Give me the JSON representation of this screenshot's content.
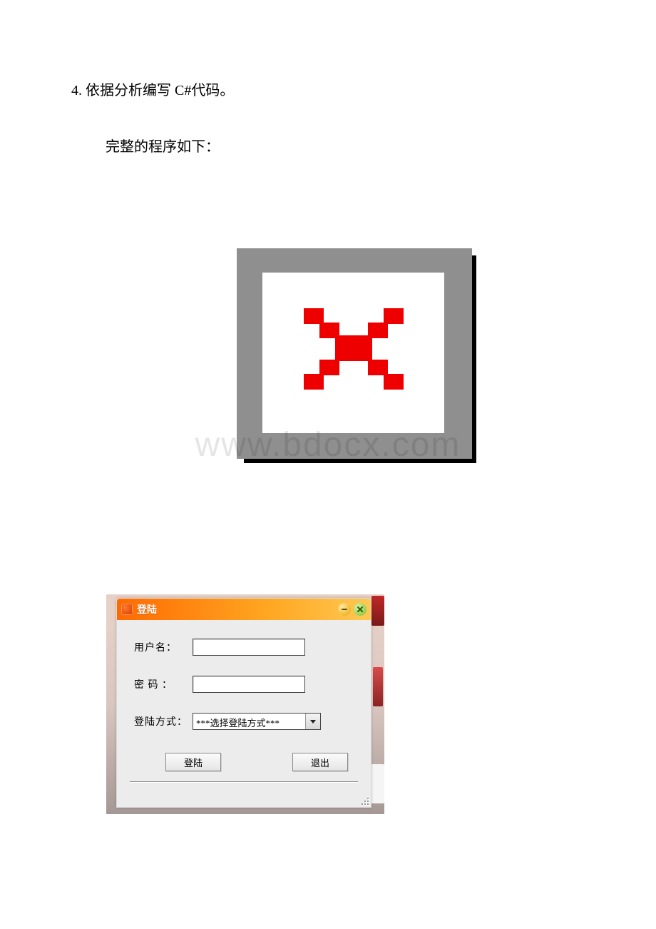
{
  "doc": {
    "heading": "4. 依据分析编写 C#代码。",
    "subtext": "完整的程序如下："
  },
  "watermark": "www.bdocx.com",
  "login": {
    "title": "登陆",
    "labels": {
      "username": "用户名：",
      "password": "密 码 ：",
      "mode": "登陆方式："
    },
    "fields": {
      "username_value": "",
      "password_value": "",
      "mode_selected": "***选择登陆方式***"
    },
    "buttons": {
      "login": "登陆",
      "exit": "退出"
    }
  }
}
